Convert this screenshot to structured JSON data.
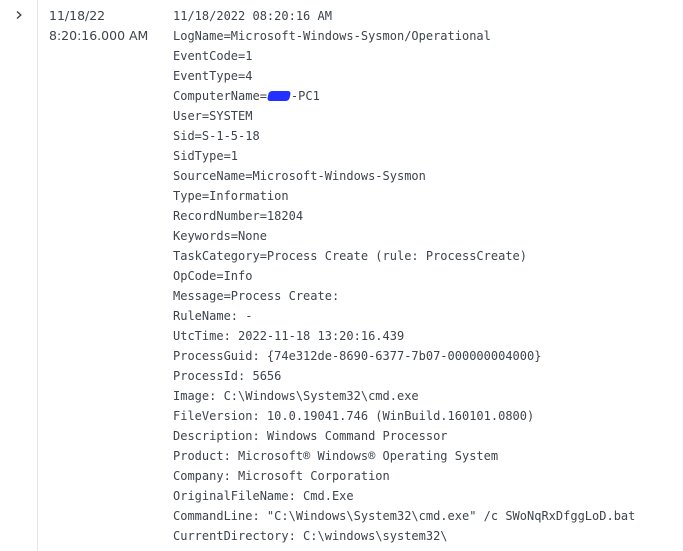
{
  "row": {
    "expand_icon": "chevron-right-icon",
    "date": "11/18/22",
    "time": "8:20:16.000 AM",
    "event_header": "11/18/2022 08:20:16 AM",
    "computer_name_prefix": "ComputerName=",
    "computer_name_suffix": "-PC1",
    "lines_a": [
      "LogName=Microsoft-Windows-Sysmon/Operational",
      "EventCode=1",
      "EventType=4"
    ],
    "lines_b": [
      "User=SYSTEM",
      "Sid=S-1-5-18",
      "SidType=1",
      "SourceName=Microsoft-Windows-Sysmon",
      "Type=Information",
      "RecordNumber=18204",
      "Keywords=None",
      "TaskCategory=Process Create (rule: ProcessCreate)",
      "OpCode=Info",
      "Message=Process Create:",
      "RuleName: -",
      "UtcTime: 2022-11-18 13:20:16.439",
      "ProcessGuid: {74e312de-8690-6377-7b07-000000004000}",
      "ProcessId: 5656",
      "Image: C:\\Windows\\System32\\cmd.exe",
      "FileVersion: 10.0.19041.746 (WinBuild.160101.0800)",
      "Description: Windows Command Processor",
      "Product: Microsoft® Windows® Operating System",
      "Company: Microsoft Corporation",
      "OriginalFileName: Cmd.Exe",
      "CommandLine: \"C:\\Windows\\System32\\cmd.exe\" /c SWoNqRxDfggLoD.bat",
      "CurrentDirectory: C:\\windows\\system32\\"
    ]
  },
  "colors": {
    "text": "#3c444d",
    "border": "#e1e4e8",
    "redaction": "#2430ff"
  }
}
